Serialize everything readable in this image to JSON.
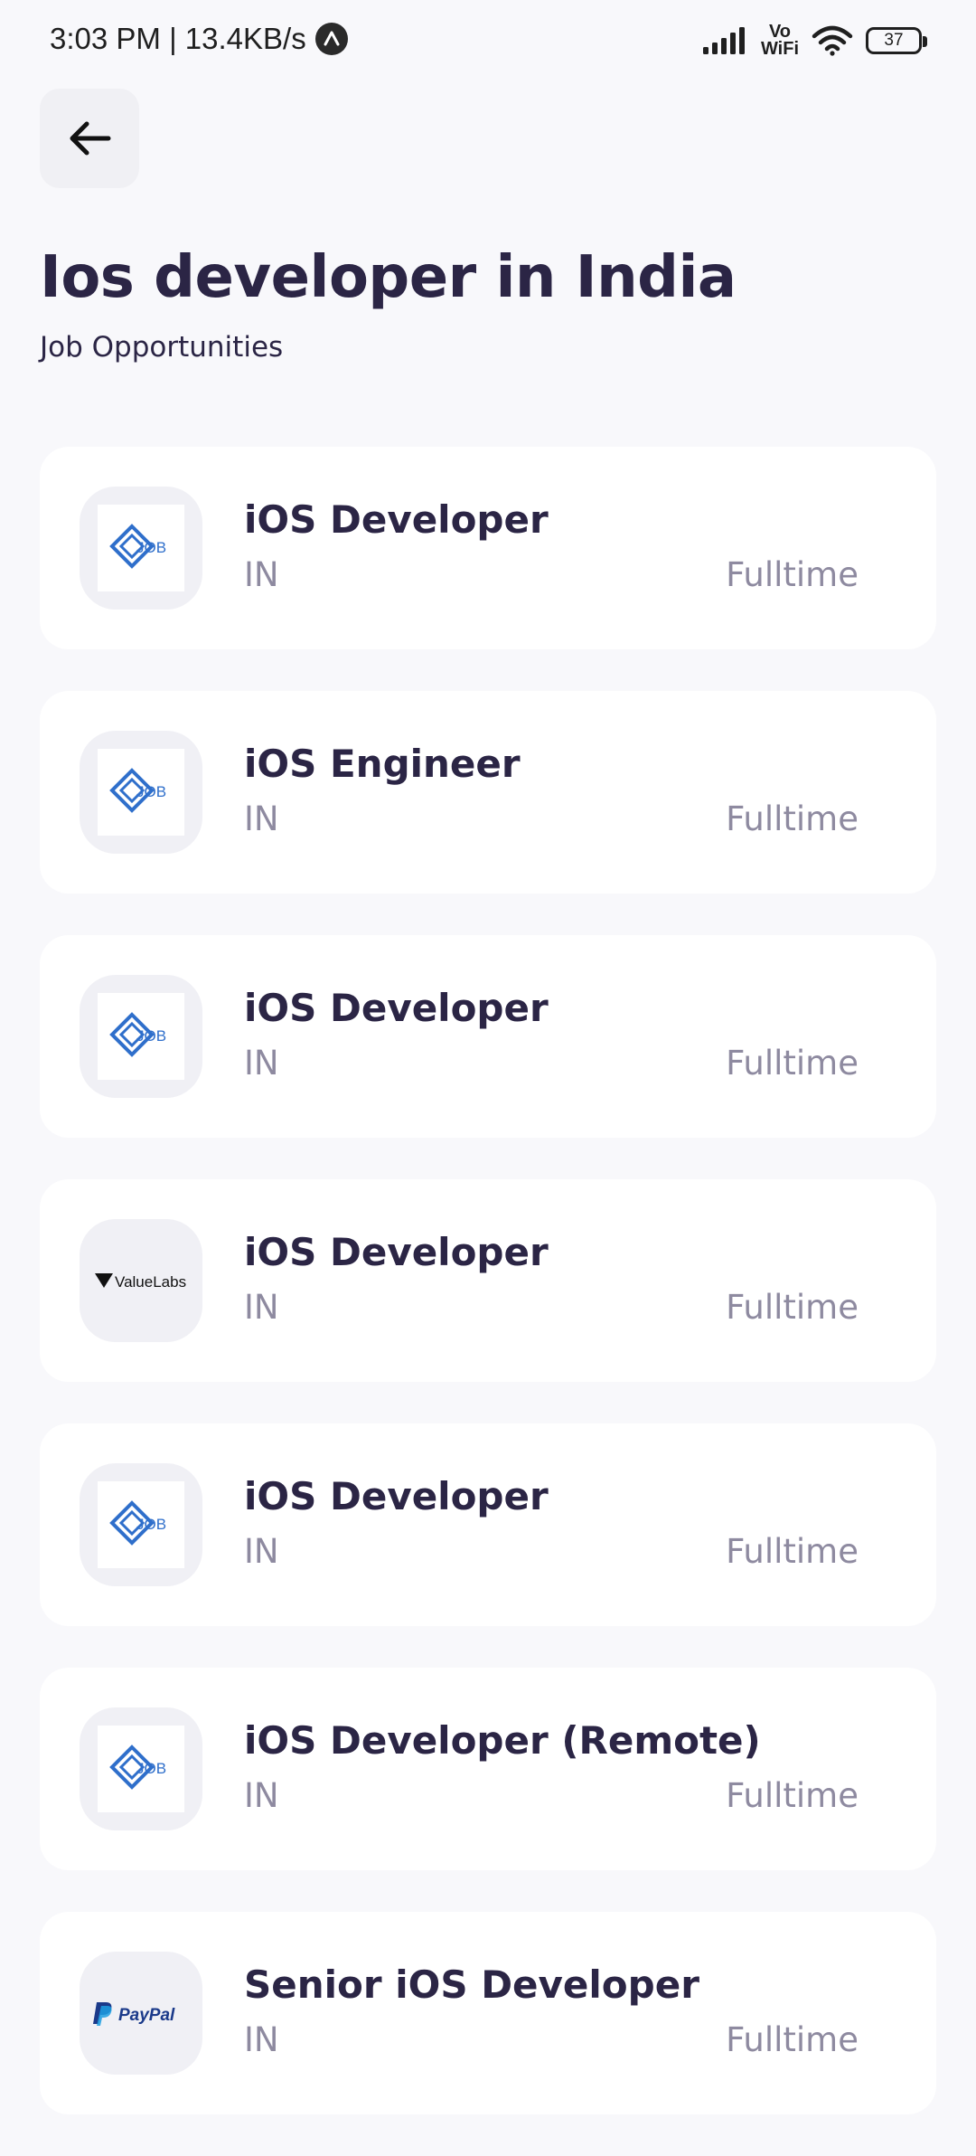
{
  "status_bar": {
    "time_speed": "3:03 PM | 13.4KB/s",
    "vowifi_line1": "Vo",
    "vowifi_line2": "WiFi",
    "battery": "37"
  },
  "header": {
    "title": "Ios developer in India",
    "subtitle": "Job Opportunities"
  },
  "colors": {
    "background": "#f8f8fb",
    "card": "#ffffff",
    "title_text": "#2b2545",
    "muted_text": "#8e8aa0",
    "job_logo_blue": "#2f6fcb",
    "paypal_dark": "#1b3a8a",
    "paypal_light": "#1c9ee0"
  },
  "jobs": [
    {
      "title": "iOS Developer",
      "location": "IN",
      "type": "Fulltime",
      "logo": "job-logo-icon",
      "logo_text": "JOB"
    },
    {
      "title": "iOS Engineer",
      "location": "IN",
      "type": "Fulltime",
      "logo": "job-logo-icon",
      "logo_text": "JOB"
    },
    {
      "title": "iOS Developer",
      "location": "IN",
      "type": "Fulltime",
      "logo": "job-logo-icon",
      "logo_text": "JOB"
    },
    {
      "title": "iOS Developer",
      "location": "IN",
      "type": "Fulltime",
      "logo": "valuelabs-logo",
      "logo_text": "ValueLabs"
    },
    {
      "title": "iOS Developer",
      "location": "IN",
      "type": "Fulltime",
      "logo": "job-logo-icon",
      "logo_text": "JOB"
    },
    {
      "title": "iOS Developer (Remote)",
      "location": "IN",
      "type": "Fulltime",
      "logo": "job-logo-icon",
      "logo_text": "JOB"
    },
    {
      "title": "Senior iOS Developer",
      "location": "IN",
      "type": "Fulltime",
      "logo": "paypal-logo",
      "logo_text": "PayPal"
    }
  ]
}
